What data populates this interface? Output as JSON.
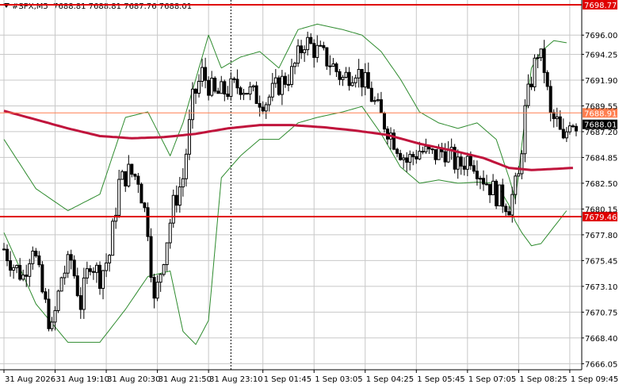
{
  "header": {
    "symbol": "#SPX,M5",
    "ohlc": "7688.81 7688.81 7687.76 7688.01"
  },
  "colors": {
    "background": "#ffffff",
    "grid": "#c8c8c8",
    "candle": "#000000",
    "ma": "#c0143c",
    "bands": "#2e8b2e",
    "resistance": "#e00000",
    "support": "#e00000",
    "current_line": "#ff7f50",
    "current_tag": "#000000"
  },
  "chart_data": {
    "type": "candlestick",
    "ylim": [
      7665.5,
      7699.2
    ],
    "x_count": 180,
    "yticks": [
      7696.0,
      7694.25,
      7691.9,
      7689.55,
      7687.2,
      7684.85,
      7682.5,
      7680.15,
      7677.8,
      7675.45,
      7673.1,
      7670.75,
      7668.4,
      7666.05
    ],
    "xticks": [
      {
        "index": 0,
        "label": "31 Aug 2026"
      },
      {
        "index": 16,
        "label": "31 Aug 19:10"
      },
      {
        "index": 32,
        "label": "31 Aug 20:30"
      },
      {
        "index": 48,
        "label": "31 Aug 21:50"
      },
      {
        "index": 64,
        "label": "31 Aug 23:10"
      },
      {
        "index": 81,
        "label": "1 Sep 01:45"
      },
      {
        "index": 97,
        "label": "1 Sep 03:05"
      },
      {
        "index": 113,
        "label": "1 Sep 04:25"
      },
      {
        "index": 129,
        "label": "1 Sep 05:45"
      },
      {
        "index": 145,
        "label": "1 Sep 07:05"
      },
      {
        "index": 161,
        "label": "1 Sep 08:25"
      },
      {
        "index": 177,
        "label": "1 Sep 09:45"
      }
    ],
    "session_separator_index": 71,
    "levels": [
      {
        "name": "resistance",
        "value": 7698.77,
        "label": "7698.77"
      },
      {
        "name": "support",
        "value": 7679.46,
        "label": "7679.46"
      },
      {
        "name": "current",
        "value": 7688.91,
        "label": "7688.91"
      },
      {
        "name": "last",
        "value": 7688.01,
        "label": "7688.01"
      }
    ],
    "close_path": [
      [
        0,
        7676.5
      ],
      [
        3,
        7675.0
      ],
      [
        6,
        7674.0
      ],
      [
        9,
        7677.0
      ],
      [
        12,
        7672.5
      ],
      [
        15,
        7669.0
      ],
      [
        18,
        7674.0
      ],
      [
        21,
        7675.5
      ],
      [
        24,
        7671.5
      ],
      [
        27,
        7675.5
      ],
      [
        30,
        7674.0
      ],
      [
        33,
        7676.0
      ],
      [
        36,
        7682.5
      ],
      [
        39,
        7683.5
      ],
      [
        42,
        7683.0
      ],
      [
        45,
        7678.5
      ],
      [
        47,
        7671.5
      ],
      [
        50,
        7676.0
      ],
      [
        53,
        7680.5
      ],
      [
        56,
        7683.0
      ],
      [
        59,
        7690.0
      ],
      [
        62,
        7692.5
      ],
      [
        66,
        7690.5
      ],
      [
        70,
        7691.0
      ],
      [
        74,
        7691.5
      ],
      [
        78,
        7690.5
      ],
      [
        82,
        7690.0
      ],
      [
        86,
        7691.5
      ],
      [
        90,
        7692.5
      ],
      [
        94,
        7695.5
      ],
      [
        98,
        7694.5
      ],
      [
        102,
        7693.5
      ],
      [
        106,
        7692.0
      ],
      [
        110,
        7693.0
      ],
      [
        114,
        7691.0
      ],
      [
        118,
        7688.5
      ],
      [
        122,
        7686.5
      ],
      [
        126,
        7684.5
      ],
      [
        130,
        7685.5
      ],
      [
        134,
        7685.0
      ],
      [
        138,
        7685.5
      ],
      [
        142,
        7684.0
      ],
      [
        146,
        7685.0
      ],
      [
        150,
        7683.0
      ],
      [
        154,
        7681.5
      ],
      [
        158,
        7680.5
      ],
      [
        161,
        7683.0
      ],
      [
        163,
        7689.0
      ],
      [
        165,
        7692.0
      ],
      [
        167,
        7694.5
      ],
      [
        169,
        7693.0
      ],
      [
        171,
        7688.5
      ],
      [
        173,
        7688.0
      ],
      [
        175,
        7686.0
      ],
      [
        177,
        7688.5
      ],
      [
        179,
        7688.0
      ]
    ],
    "ma_path": [
      [
        0,
        7689.1
      ],
      [
        10,
        7688.3
      ],
      [
        20,
        7687.5
      ],
      [
        30,
        7686.8
      ],
      [
        40,
        7686.6
      ],
      [
        50,
        7686.7
      ],
      [
        60,
        7687.0
      ],
      [
        70,
        7687.5
      ],
      [
        80,
        7687.8
      ],
      [
        90,
        7687.8
      ],
      [
        100,
        7687.6
      ],
      [
        110,
        7687.3
      ],
      [
        120,
        7686.9
      ],
      [
        130,
        7686.1
      ],
      [
        140,
        7685.5
      ],
      [
        150,
        7684.8
      ],
      [
        158,
        7683.9
      ],
      [
        165,
        7683.7
      ],
      [
        172,
        7683.8
      ],
      [
        178,
        7683.9
      ]
    ],
    "band_upper_path": [
      [
        0,
        7686.5
      ],
      [
        10,
        7682.0
      ],
      [
        20,
        7680.0
      ],
      [
        30,
        7681.5
      ],
      [
        38,
        7688.5
      ],
      [
        45,
        7689.0
      ],
      [
        52,
        7685.0
      ],
      [
        56,
        7688.0
      ],
      [
        60,
        7692.0
      ],
      [
        64,
        7696.0
      ],
      [
        68,
        7693.0
      ],
      [
        74,
        7694.0
      ],
      [
        80,
        7694.5
      ],
      [
        86,
        7693.0
      ],
      [
        92,
        7696.5
      ],
      [
        98,
        7697.0
      ],
      [
        106,
        7696.5
      ],
      [
        112,
        7696.0
      ],
      [
        118,
        7694.5
      ],
      [
        124,
        7692.0
      ],
      [
        130,
        7689.0
      ],
      [
        136,
        7688.0
      ],
      [
        142,
        7687.5
      ],
      [
        148,
        7688.0
      ],
      [
        154,
        7686.5
      ],
      [
        158,
        7683.0
      ],
      [
        160,
        7681.0
      ],
      [
        162,
        7686.0
      ],
      [
        165,
        7693.0
      ],
      [
        168,
        7694.5
      ],
      [
        172,
        7695.5
      ],
      [
        176,
        7695.3
      ]
    ],
    "band_lower_path": [
      [
        0,
        7678.0
      ],
      [
        10,
        7671.5
      ],
      [
        20,
        7668.0
      ],
      [
        30,
        7668.0
      ],
      [
        38,
        7671.0
      ],
      [
        45,
        7674.0
      ],
      [
        52,
        7674.5
      ],
      [
        56,
        7669.0
      ],
      [
        60,
        7667.8
      ],
      [
        64,
        7670.0
      ],
      [
        68,
        7683.0
      ],
      [
        74,
        7685.0
      ],
      [
        80,
        7686.5
      ],
      [
        86,
        7686.5
      ],
      [
        92,
        7688.0
      ],
      [
        98,
        7688.5
      ],
      [
        106,
        7689.0
      ],
      [
        112,
        7689.5
      ],
      [
        118,
        7687.0
      ],
      [
        124,
        7684.0
      ],
      [
        130,
        7682.5
      ],
      [
        136,
        7682.8
      ],
      [
        142,
        7682.5
      ],
      [
        148,
        7682.6
      ],
      [
        154,
        7682.5
      ],
      [
        158,
        7680.5
      ],
      [
        160,
        7679.0
      ],
      [
        162,
        7678.0
      ],
      [
        165,
        7676.8
      ],
      [
        168,
        7677.0
      ],
      [
        172,
        7678.5
      ],
      [
        176,
        7680.0
      ]
    ]
  }
}
